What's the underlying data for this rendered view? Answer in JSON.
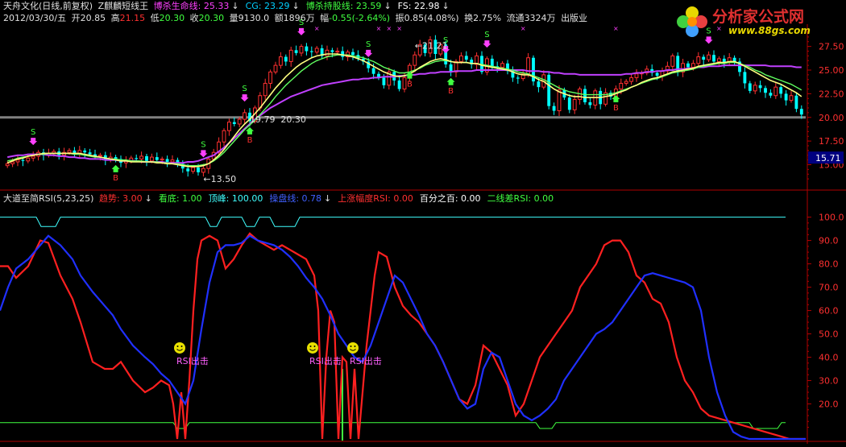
{
  "header": {
    "stock": "天舟文化(日线,前复权)",
    "indicator": "Z麒麟短线王",
    "lines": [
      {
        "label": "博杀生命线:",
        "value": "25.33",
        "arrow": "↓",
        "color": "#ff40ff"
      },
      {
        "label": "CG:",
        "value": "23.29",
        "arrow": "↓",
        "color": "#00d0ff"
      },
      {
        "label": "博杀持股线:",
        "value": "23.59",
        "arrow": "↓",
        "color": "#40ff40"
      },
      {
        "label": "FS:",
        "value": "22.98",
        "arrow": "↓",
        "color": "#ffffff"
      }
    ]
  },
  "info": {
    "date": "2012/03/30/五",
    "open_label": "开",
    "open": "20.85",
    "high_label": "高",
    "high": "21.15",
    "low_label": "低",
    "low": "20.30",
    "close_label": "收",
    "close": "20.30",
    "vol_label": "量",
    "vol": "9130.0",
    "amount_label": "额",
    "amount": "1896万",
    "chg_label": "幅",
    "chg": "-0.55(-2.64%)",
    "amp_label": "振",
    "amp": "0.85(4.08%)",
    "turn_label": "换",
    "turn": "2.75%",
    "float_label": "流通",
    "float": "3324万",
    "sector": "出版业"
  },
  "sub_header": {
    "name": "大道至简RSI(5,23,25)",
    "items": [
      {
        "label": "趋势:",
        "value": "3.00",
        "arrow": "↓",
        "color": "#ff3030"
      },
      {
        "label": "看底:",
        "value": "1.00",
        "arrow": "",
        "color": "#40ff40"
      },
      {
        "label": "顶峰:",
        "value": "100.00",
        "arrow": "",
        "color": "#40ffff"
      },
      {
        "label": "操盘线:",
        "value": "0.78",
        "arrow": "↓",
        "color": "#4060ff"
      },
      {
        "label": "上涨幅度RSI:",
        "value": "0.00",
        "arrow": "",
        "color": "#ff3030"
      },
      {
        "label": "百分之百:",
        "value": "0.00",
        "arrow": "",
        "color": "#ffffff"
      },
      {
        "label": "二线差RSI:",
        "value": "0.00",
        "arrow": "",
        "color": "#40ff40"
      }
    ]
  },
  "logo": {
    "title": "分析家公式网",
    "url": "www.88gs.com"
  },
  "colors": {
    "up": "#ff3030",
    "down": "#00ffff",
    "axis": "#b00000",
    "grid": "#b00000",
    "ma_long": "#c040ff",
    "ma_short": "#ffff80",
    "ma_mid": "#60ff60",
    "rsi_fast": "#ff2020",
    "rsi_slow": "#2030ff"
  },
  "chart_data": [
    {
      "type": "candlestick",
      "ylim": [
        13,
        29
      ],
      "yticks": [
        15.0,
        17.5,
        20.0,
        22.5,
        25.0,
        27.5
      ],
      "current_price_label": "15.71",
      "annotations": [
        {
          "text": "←13.50",
          "x": 38,
          "y": 13.5
        },
        {
          "text": "19.79",
          "x": 47,
          "y": 19.79
        },
        {
          "text": "20.30",
          "x": 53,
          "y": 19.79
        },
        {
          "text": "←21.21",
          "x": 79,
          "y": 27.6
        }
      ],
      "signals_s": [
        5,
        38,
        46,
        57,
        70,
        85,
        93,
        136
      ],
      "signals_b": [
        21,
        47,
        78,
        86,
        118
      ],
      "close": [
        15.1,
        15.3,
        15.5,
        15.4,
        15.7,
        15.9,
        16.3,
        16.0,
        16.2,
        16.4,
        16.0,
        16.3,
        16.5,
        16.2,
        16.5,
        16.3,
        16.1,
        15.9,
        16.0,
        15.5,
        15.8,
        15.6,
        15.2,
        15.4,
        15.7,
        15.6,
        15.9,
        15.4,
        15.8,
        15.5,
        15.6,
        15.3,
        15.5,
        15.1,
        14.6,
        14.3,
        14.7,
        14.2,
        14.6,
        15.6,
        16.3,
        17.4,
        18.6,
        19.5,
        19.3,
        19.8,
        20.5,
        19.6,
        21.0,
        22.3,
        23.6,
        24.8,
        25.5,
        26.4,
        25.9,
        27.1,
        26.8,
        27.5,
        27.0,
        26.9,
        27.3,
        26.5,
        27.1,
        26.9,
        27.0,
        26.4,
        26.9,
        26.6,
        26.2,
        25.9,
        25.2,
        24.6,
        24.2,
        23.4,
        24.8,
        23.9,
        23.0,
        24.2,
        25.5,
        26.6,
        27.7,
        26.8,
        28.2,
        26.7,
        27.7,
        25.6,
        24.8,
        25.9,
        26.5,
        26.1,
        25.6,
        26.5,
        24.8,
        26.2,
        25.4,
        25.3,
        25.7,
        24.9,
        24.2,
        24.1,
        24.6,
        26.3,
        23.8,
        23.2,
        24.5,
        21.2,
        20.7,
        22.9,
        22.1,
        20.8,
        21.9,
        23.0,
        21.6,
        21.3,
        22.8,
        21.4,
        22.6,
        22.2,
        23.0,
        23.6,
        23.8,
        24.2,
        24.6,
        24.7,
        25.1,
        24.7,
        24.4,
        24.9,
        25.4,
        26.5,
        24.8,
        25.7,
        25.3,
        25.7,
        26.4,
        26.1,
        26.6,
        25.9,
        26.2,
        25.8,
        26.3,
        25.9,
        24.8,
        23.6,
        22.8,
        23.4,
        23.1,
        22.6,
        22.3,
        23.2,
        22.5,
        21.8,
        22.3,
        20.9,
        20.3
      ],
      "ma_long": [
        15.8,
        15.9,
        16.0,
        16.0,
        16.1,
        16.1,
        16.1,
        16.1,
        16.0,
        16.0,
        15.9,
        15.9,
        15.8,
        15.8,
        15.7,
        15.7,
        15.6,
        15.6,
        15.6,
        15.5,
        15.5,
        15.5,
        15.4,
        15.4,
        15.4,
        15.4,
        15.3,
        15.3,
        15.3,
        15.3,
        15.3,
        15.2,
        15.2,
        15.2,
        15.2,
        15.3,
        15.3,
        15.4,
        15.6,
        15.8,
        16.0,
        16.4,
        16.8,
        17.3,
        17.8,
        18.3,
        18.8,
        19.3,
        19.8,
        20.2,
        20.6,
        21.0,
        21.3,
        21.6,
        21.9,
        22.2,
        22.4,
        22.6,
        22.8,
        23.0,
        23.2,
        23.4,
        23.5,
        23.6,
        23.7,
        23.8,
        23.9,
        24.0,
        24.0,
        24.1,
        24.1,
        24.2,
        24.2,
        24.3,
        24.3,
        24.3,
        24.4,
        24.4,
        24.5,
        24.5,
        24.6,
        24.6,
        24.7,
        24.7,
        24.8,
        24.8,
        24.8,
        24.9,
        24.9,
        24.9,
        24.9,
        25.0,
        25.0,
        25.0,
        25.0,
        25.0,
        25.0,
        25.0,
        25.0,
        25.0,
        25.0,
        24.9,
        24.9,
        24.9,
        24.8,
        24.8,
        24.7,
        24.7,
        24.6,
        24.6,
        24.6,
        24.5,
        24.5,
        24.5,
        24.5,
        24.5,
        24.5,
        24.5,
        24.5,
        24.5,
        24.6,
        24.6,
        24.7,
        24.7,
        24.8,
        24.8,
        24.9,
        24.9,
        25.0,
        25.0,
        25.1,
        25.1,
        25.2,
        25.2,
        25.3,
        25.3,
        25.4,
        25.4,
        25.4,
        25.5,
        25.5,
        25.5,
        25.5,
        25.5,
        25.5,
        25.5,
        25.5,
        25.5,
        25.4,
        25.4,
        25.4,
        25.4,
        25.4,
        25.3,
        25.3
      ],
      "ma_short": [
        15.2,
        15.4,
        15.6,
        15.7,
        15.9,
        16.0,
        16.1,
        16.2,
        16.2,
        16.2,
        16.2,
        16.2,
        16.2,
        16.2,
        16.2,
        16.1,
        16.0,
        15.9,
        15.8,
        15.7,
        15.6,
        15.5,
        15.4,
        15.4,
        15.3,
        15.3,
        15.3,
        15.3,
        15.3,
        15.2,
        15.2,
        15.1,
        15.1,
        15.0,
        14.9,
        14.8,
        14.8,
        14.8,
        14.9,
        15.1,
        15.5,
        16.0,
        16.6,
        17.3,
        18.0,
        18.7,
        19.3,
        19.8,
        20.4,
        21.0,
        21.7,
        22.4,
        23.1,
        23.7,
        24.3,
        24.8,
        25.3,
        25.7,
        26.0,
        26.3,
        26.5,
        26.6,
        26.7,
        26.7,
        26.7,
        26.6,
        26.5,
        26.4,
        26.2,
        26.0,
        25.7,
        25.4,
        25.1,
        24.8,
        24.6,
        24.4,
        24.3,
        24.4,
        24.6,
        24.9,
        25.3,
        25.6,
        25.9,
        26.1,
        26.2,
        26.1,
        25.9,
        25.8,
        25.8,
        25.8,
        25.7,
        25.7,
        25.5,
        25.4,
        25.3,
        25.2,
        25.1,
        25.0,
        24.8,
        24.6,
        24.5,
        24.5,
        24.3,
        24.0,
        23.8,
        23.4,
        23.0,
        22.7,
        22.5,
        22.3,
        22.2,
        22.2,
        22.1,
        22.1,
        22.1,
        22.1,
        22.2,
        22.3,
        22.5,
        22.7,
        22.9,
        23.2,
        23.4,
        23.7,
        23.9,
        24.1,
        24.2,
        24.4,
        24.6,
        24.8,
        24.9,
        25.0,
        25.1,
        25.2,
        25.4,
        25.5,
        25.6,
        25.7,
        25.8,
        25.8,
        25.9,
        25.9,
        25.7,
        25.4,
        25.1,
        24.8,
        24.5,
        24.2,
        23.9,
        23.7,
        23.5,
        23.2,
        22.9,
        22.6,
        22.2
      ],
      "ma_mid": [
        15.4,
        15.5,
        15.7,
        15.8,
        15.9,
        16.0,
        16.1,
        16.1,
        16.2,
        16.2,
        16.2,
        16.2,
        16.2,
        16.1,
        16.1,
        16.0,
        15.9,
        15.8,
        15.8,
        15.7,
        15.6,
        15.6,
        15.5,
        15.5,
        15.4,
        15.4,
        15.4,
        15.3,
        15.3,
        15.3,
        15.2,
        15.2,
        15.1,
        15.1,
        15.0,
        14.9,
        14.9,
        14.9,
        15.0,
        15.1,
        15.4,
        15.8,
        16.3,
        16.9,
        17.5,
        18.1,
        18.7,
        19.2,
        19.7,
        20.3,
        20.9,
        21.5,
        22.2,
        22.8,
        23.4,
        23.9,
        24.4,
        24.9,
        25.3,
        25.7,
        26.0,
        26.2,
        26.4,
        26.5,
        26.6,
        26.6,
        26.6,
        26.5,
        26.4,
        26.3,
        26.1,
        25.9,
        25.6,
        25.3,
        25.1,
        24.9,
        24.7,
        24.7,
        24.8,
        25.0,
        25.2,
        25.5,
        25.7,
        25.9,
        26.0,
        26.0,
        25.9,
        25.8,
        25.8,
        25.8,
        25.7,
        25.7,
        25.6,
        25.5,
        25.4,
        25.3,
        25.2,
        25.1,
        25.0,
        24.8,
        24.7,
        24.6,
        24.4,
        24.2,
        24.0,
        23.7,
        23.4,
        23.1,
        22.9,
        22.7,
        22.6,
        22.5,
        22.4,
        22.4,
        22.4,
        22.4,
        22.4,
        22.5,
        22.6,
        22.8,
        23.0,
        23.2,
        23.4,
        23.6,
        23.8,
        24.0,
        24.1,
        24.3,
        24.5,
        24.7,
        24.8,
        24.9,
        25.0,
        25.1,
        25.3,
        25.4,
        25.5,
        25.6,
        25.7,
        25.7,
        25.8,
        25.8,
        25.7,
        25.5,
        25.3,
        25.0,
        24.8,
        24.5,
        24.3,
        24.1,
        23.9,
        23.7,
        23.5,
        23.2,
        22.9
      ]
    },
    {
      "type": "line",
      "ylim": [
        5,
        104
      ],
      "yticks": [
        20.0,
        30.0,
        40.0,
        50.0,
        60.0,
        70.0,
        80.0,
        90.0,
        100.0
      ],
      "signal_label": "RSI出击",
      "signals_x": [
        0.223,
        0.388,
        0.438
      ],
      "green_spike_x": 0.425,
      "series": [
        {
          "name": "",
          "color": "#ff2020",
          "x": [
            0.0,
            0.01,
            0.02,
            0.035,
            0.05,
            0.06,
            0.075,
            0.09,
            0.1,
            0.115,
            0.13,
            0.14,
            0.15,
            0.165,
            0.18,
            0.19,
            0.2,
            0.21,
            0.215,
            0.22,
            0.225,
            0.23,
            0.235,
            0.24,
            0.245,
            0.25,
            0.26,
            0.27,
            0.28,
            0.29,
            0.3,
            0.31,
            0.32,
            0.33,
            0.34,
            0.35,
            0.36,
            0.37,
            0.38,
            0.39,
            0.395,
            0.4,
            0.405,
            0.41,
            0.415,
            0.42,
            0.425,
            0.43,
            0.435,
            0.44,
            0.445,
            0.45,
            0.455,
            0.46,
            0.465,
            0.47,
            0.48,
            0.49,
            0.5,
            0.51,
            0.52,
            0.53,
            0.54,
            0.55,
            0.56,
            0.57,
            0.58,
            0.59,
            0.6,
            0.61,
            0.62,
            0.63,
            0.64,
            0.65,
            0.66,
            0.67,
            0.68,
            0.69,
            0.7,
            0.71,
            0.72,
            0.73,
            0.74,
            0.75,
            0.76,
            0.77,
            0.78,
            0.79,
            0.8,
            0.81,
            0.82,
            0.83,
            0.84,
            0.85,
            0.86,
            0.87,
            0.88,
            0.89,
            0.9,
            0.91,
            0.92,
            0.93,
            0.94,
            0.95,
            0.96,
            0.97,
            0.98,
            0.99,
            1.0
          ],
          "values": [
            79,
            79,
            74,
            79,
            90,
            89,
            75,
            65,
            55,
            38,
            35,
            35,
            38,
            30,
            25,
            27,
            30,
            28,
            20,
            5,
            25,
            5,
            30,
            60,
            82,
            90,
            92,
            90,
            78,
            82,
            88,
            93,
            90,
            88,
            86,
            88,
            86,
            84,
            82,
            75,
            60,
            5,
            40,
            60,
            55,
            5,
            40,
            38,
            5,
            35,
            5,
            25,
            45,
            60,
            75,
            85,
            83,
            70,
            62,
            58,
            55,
            50,
            45,
            38,
            30,
            22,
            20,
            28,
            45,
            42,
            35,
            28,
            15,
            20,
            30,
            40,
            45,
            50,
            55,
            60,
            70,
            75,
            80,
            88,
            90,
            90,
            85,
            75,
            72,
            65,
            63,
            55,
            40,
            30,
            25,
            18,
            15,
            14,
            13,
            12,
            11,
            10,
            9,
            8,
            7,
            6,
            5,
            5,
            5
          ]
        },
        {
          "name": "",
          "color": "#2030ff",
          "x": [
            0.0,
            0.01,
            0.02,
            0.035,
            0.05,
            0.06,
            0.075,
            0.09,
            0.1,
            0.115,
            0.13,
            0.14,
            0.15,
            0.165,
            0.18,
            0.19,
            0.2,
            0.21,
            0.22,
            0.23,
            0.24,
            0.25,
            0.26,
            0.27,
            0.28,
            0.29,
            0.3,
            0.31,
            0.32,
            0.33,
            0.34,
            0.35,
            0.36,
            0.37,
            0.38,
            0.39,
            0.4,
            0.41,
            0.42,
            0.43,
            0.44,
            0.45,
            0.46,
            0.47,
            0.48,
            0.49,
            0.5,
            0.51,
            0.52,
            0.53,
            0.54,
            0.55,
            0.56,
            0.57,
            0.58,
            0.59,
            0.6,
            0.61,
            0.62,
            0.63,
            0.64,
            0.65,
            0.66,
            0.67,
            0.68,
            0.69,
            0.7,
            0.71,
            0.72,
            0.73,
            0.74,
            0.75,
            0.76,
            0.77,
            0.78,
            0.79,
            0.8,
            0.81,
            0.82,
            0.83,
            0.84,
            0.85,
            0.86,
            0.87,
            0.88,
            0.89,
            0.9,
            0.91,
            0.92,
            0.93,
            0.94,
            0.95,
            0.96,
            0.97,
            0.98,
            0.99,
            1.0
          ],
          "values": [
            60,
            70,
            78,
            82,
            88,
            92,
            88,
            82,
            75,
            68,
            62,
            58,
            52,
            45,
            40,
            37,
            33,
            30,
            25,
            20,
            30,
            52,
            72,
            85,
            88,
            88,
            89,
            92,
            90,
            89,
            88,
            86,
            83,
            79,
            74,
            70,
            65,
            58,
            50,
            45,
            40,
            38,
            45,
            55,
            65,
            75,
            72,
            65,
            58,
            50,
            45,
            38,
            30,
            22,
            18,
            20,
            35,
            42,
            40,
            30,
            20,
            15,
            13,
            15,
            18,
            22,
            30,
            35,
            40,
            45,
            50,
            52,
            55,
            60,
            65,
            70,
            75,
            76,
            75,
            74,
            73,
            72,
            70,
            60,
            40,
            25,
            15,
            8,
            6,
            5,
            5,
            5,
            5,
            5,
            5,
            5,
            5
          ]
        }
      ]
    }
  ]
}
